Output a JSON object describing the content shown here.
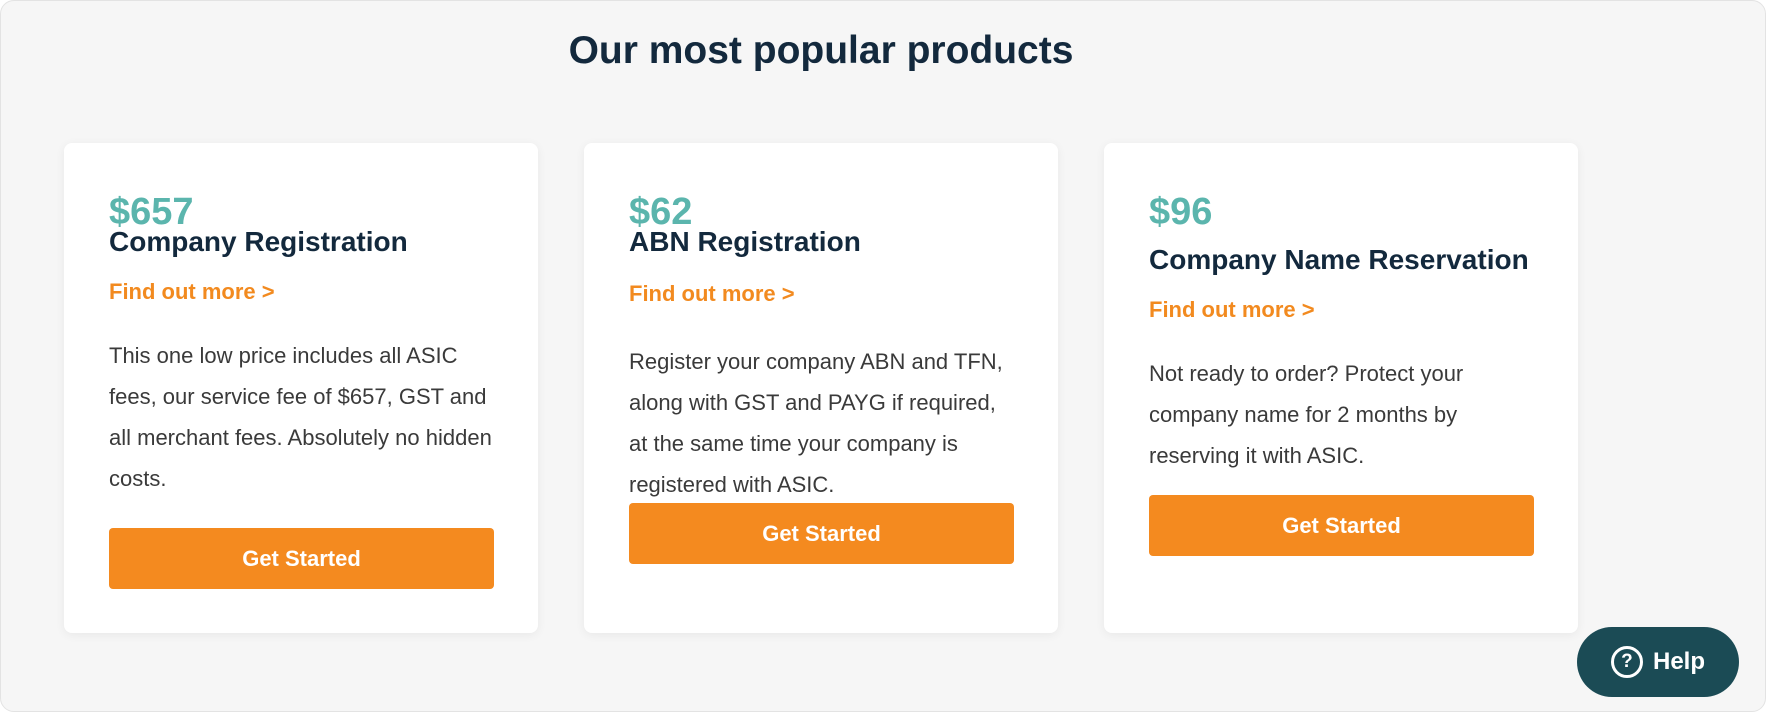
{
  "section": {
    "heading": "Our most popular products"
  },
  "products": [
    {
      "price": "$657",
      "title": "Company Registration",
      "link": "Find out more >",
      "description": "This one low price includes all ASIC fees, our service fee of $657, GST and all merchant fees. Absolutely no hidden costs.",
      "button": "Get Started"
    },
    {
      "price": "$62",
      "title": "ABN Registration",
      "link": "Find out more >",
      "description": "Register your company ABN and TFN, along with GST and PAYG if required, at the same time your company is registered with ASIC.",
      "button": "Get Started"
    },
    {
      "price": "$96",
      "title": "Company Name Reservation",
      "link": "Find out more >",
      "description": "Not ready to order? Protect your company name for 2 months by reserving it with ASIC.",
      "button": "Get Started"
    }
  ],
  "help_widget": {
    "icon": "question-circle-icon",
    "label": "Help"
  },
  "colors": {
    "heading": "#13293d",
    "price": "#5bb5ad",
    "accent": "#f48a1f",
    "help_bg": "#1b4b55",
    "section_bg": "#f6f6f6"
  }
}
